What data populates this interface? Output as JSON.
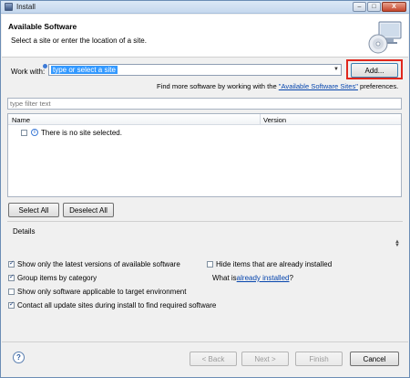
{
  "window": {
    "title": "Install",
    "minimize": "–",
    "maximize": "□",
    "close": "X"
  },
  "header": {
    "title": "Available Software",
    "subtitle": "Select a site or enter the location of a site.",
    "graphic_icon": "cd-install-icon"
  },
  "work_with": {
    "label": "Work with:",
    "combo_value": "type or select a site",
    "add_button": "Add..."
  },
  "find_more": {
    "prefix": "Find more software by working with the ",
    "link": "\"Available Software Sites\"",
    "suffix": " preferences."
  },
  "filter": {
    "placeholder": "type filter text"
  },
  "table": {
    "columns": [
      "Name",
      "Version"
    ],
    "rows": [
      {
        "checked": false,
        "icon": "info-icon",
        "text": "There is no site selected."
      }
    ]
  },
  "selection_buttons": {
    "select_all": "Select All",
    "deselect_all": "Deselect All"
  },
  "details": {
    "label": "Details"
  },
  "options": {
    "latest_versions": {
      "label": "Show only the latest versions of available software",
      "checked": true
    },
    "group_by_category": {
      "label": "Group items by category",
      "checked": true
    },
    "target_env": {
      "label": "Show only software applicable to target environment",
      "checked": false
    },
    "contact_sites": {
      "label": "Contact all update sites during install to find required software",
      "checked": true
    },
    "hide_installed": {
      "label": "Hide items that are already installed",
      "checked": false
    },
    "what_is_prefix": "What is ",
    "what_is_link": "already installed",
    "what_is_suffix": "?"
  },
  "footer": {
    "help": "?",
    "back": "< Back",
    "next": "Next >",
    "finish": "Finish",
    "cancel": "Cancel"
  },
  "colors": {
    "highlight": "#e0271d",
    "selection": "#3399ff",
    "link": "#0645ad"
  }
}
